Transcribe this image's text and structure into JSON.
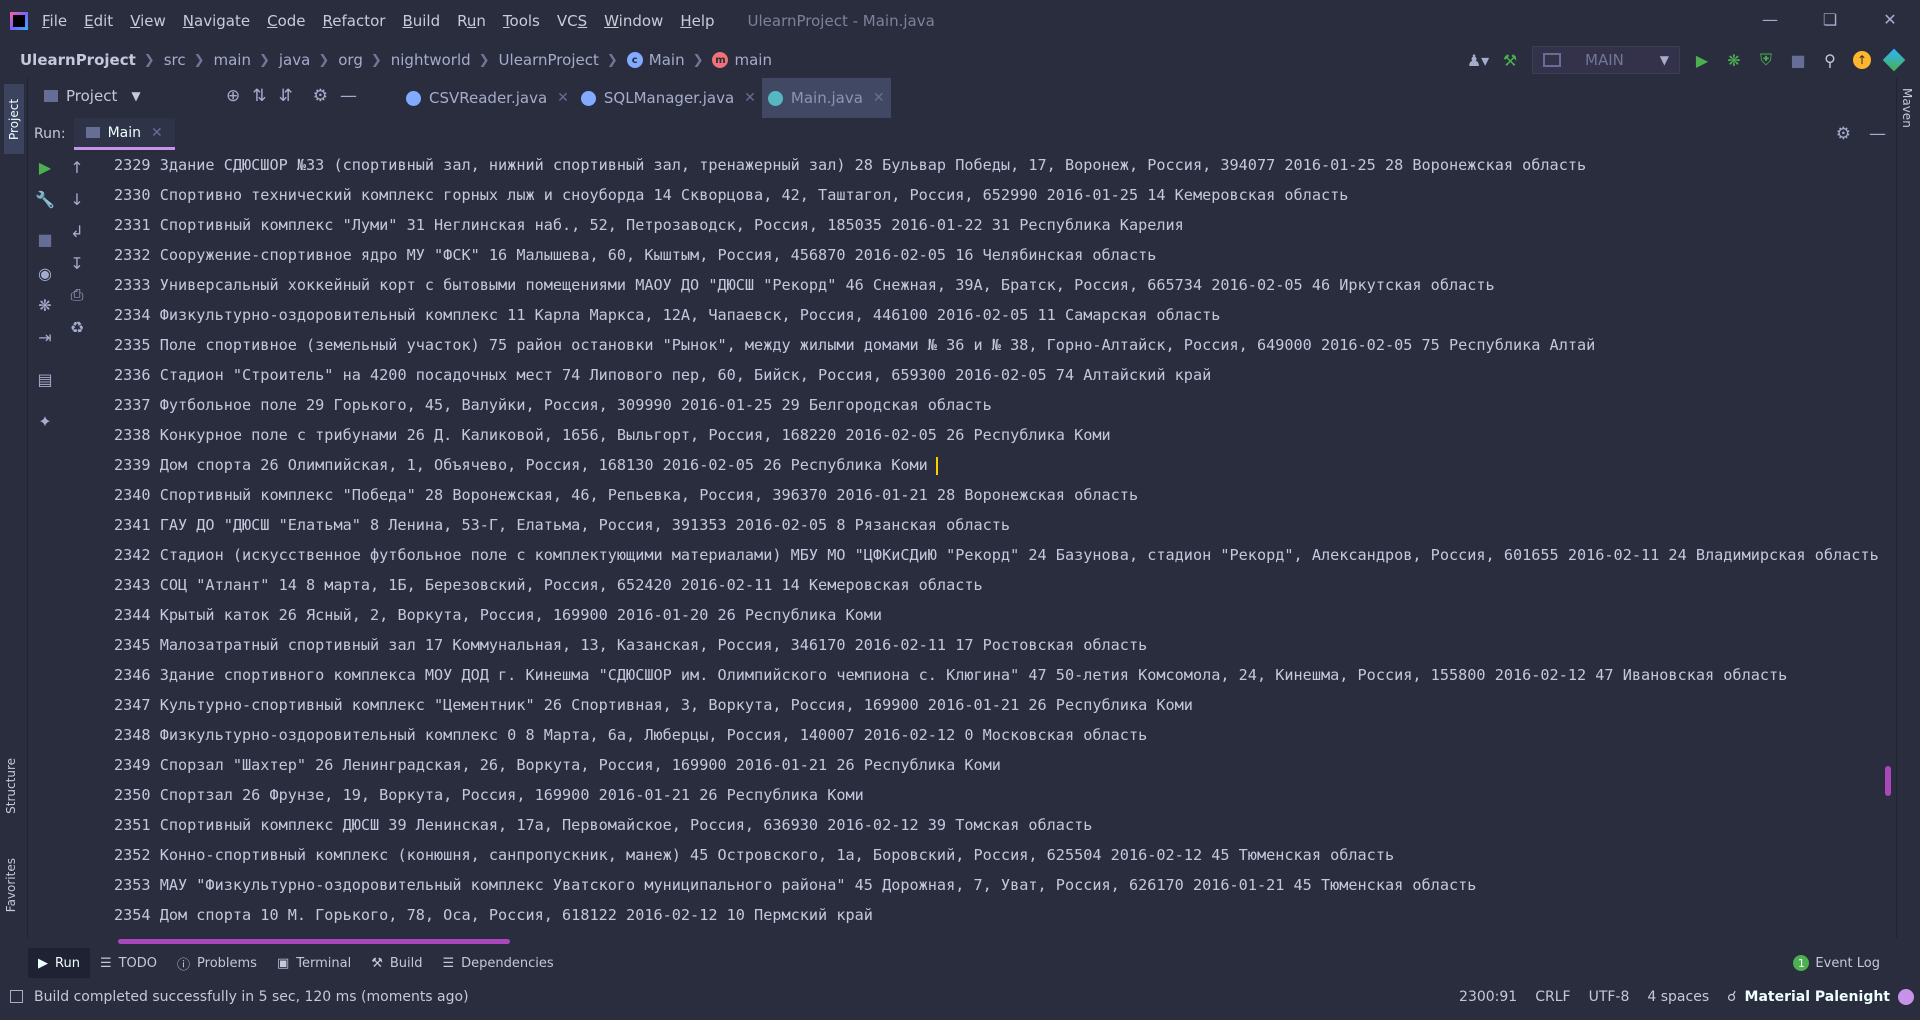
{
  "menu": [
    {
      "label": "File",
      "u": "F"
    },
    {
      "label": "Edit",
      "u": "E"
    },
    {
      "label": "View",
      "u": "V"
    },
    {
      "label": "Navigate",
      "u": "N"
    },
    {
      "label": "Code",
      "u": "C"
    },
    {
      "label": "Refactor",
      "u": "R"
    },
    {
      "label": "Build",
      "u": "B"
    },
    {
      "label": "Run",
      "u": "u"
    },
    {
      "label": "Tools",
      "u": "T"
    },
    {
      "label": "VCS",
      "u": "S"
    },
    {
      "label": "Window",
      "u": "W"
    },
    {
      "label": "Help",
      "u": "H"
    }
  ],
  "window_title": "UlearnProject - Main.java",
  "breadcrumbs": {
    "project": "UlearnProject",
    "items": [
      "src",
      "main",
      "java",
      "org",
      "nightworld",
      "UlearnProject"
    ],
    "class": "Main",
    "method": "main"
  },
  "run_config": {
    "label": "MAIN"
  },
  "project_panel": {
    "label": "Project"
  },
  "editor_tabs": [
    "CSVReader.java",
    "SQLManager.java",
    "Main.java"
  ],
  "run_panel": {
    "label": "Run:",
    "tab": "Main"
  },
  "side_tabs": {
    "project": "Project",
    "structure": "Structure",
    "favorites": "Favorites",
    "maven": "Maven"
  },
  "console_lines": [
    "2329 Здание СДЮСШОР №33 (спортивный зал, нижний спортивный зал, тренажерный зал) 28 Бульвар Победы, 17, Воронеж, Россия, 394077 2016-01-25 28 Воронежская область",
    "2330 Спортивно технический комплекс горных лыж и сноуборда 14 Скворцова, 42, Таштагол, Россия, 652990 2016-01-25 14 Кемеровская область",
    "2331 Спортивный комплекс \"Луми\" 31 Неглинская наб., 52, Петрозаводск, Россия, 185035 2016-01-22 31 Республика Карелия",
    "2332 Сооружение-спортивное ядро МУ \"ФСК\" 16 Малышева, 60, Кыштым, Россия, 456870 2016-02-05 16 Челябинская область",
    "2333 Универсальный хоккейный корт с бытовыми помещениями МАОУ ДО \"ДЮСШ \"Рекорд\" 46 Снежная, 39А, Братск, Россия, 665734 2016-02-05 46 Иркутская область",
    "2334 Физкультурно-оздоровительный комплекс 11 Карла Маркса, 12А, Чапаевск, Россия, 446100 2016-02-05 11 Самарская область",
    "2335 Поле спортивное (земельный участок) 75 район остановки \"Рынок\", между жилыми домами № 36 и № 38, Горно-Алтайск, Россия, 649000 2016-02-05 75 Республика Алтай",
    "2336 Стадион \"Строитель\" на 4200 посадочных мест 74 Липового пер, 60, Бийск, Россия, 659300 2016-02-05 74 Алтайский край",
    "2337 Футбольное поле 29 Горького, 45, Валуйки, Россия, 309990 2016-01-25 29 Белгородская область",
    "2338 Конкурное поле с трибунами 26 Д. Каликовой, 1656, Выльгорт, Россия, 168220 2016-02-05 26 Республика Коми",
    "2339 Дом спорта 26 Олимпийская, 1, Объячево, Россия, 168130 2016-02-05 26 Республика Коми",
    "2340 Спортивный комплекс \"Победа\" 28 Воронежская, 46, Репьевка, Россия, 396370 2016-01-21 28 Воронежская область",
    "2341 ГАУ ДО \"ДЮСШ \"Елатьма\" 8 Ленина, 53-Г, Елатьма, Россия, 391353 2016-02-05 8 Рязанская область",
    "2342 Стадион (искусственное футбольное поле с комплектующими материалами) МБУ МО \"ЦФКиСДиЮ \"Рекорд\" 24 Базунова, стадион \"Рекорд\", Александров, Россия, 601655 2016-02-11 24 Владимирская область",
    "2343 СОЦ \"Атлант\" 14 8 марта, 1Б, Березовский, Россия, 652420 2016-02-11 14 Кемеровская область",
    "2344 Крытый каток 26 Ясный, 2, Воркута, Россия, 169900 2016-01-20 26 Республика Коми",
    "2345 Малозатратный спортивный зал 17 Коммунальная, 13, Казанская, Россия, 346170 2016-02-11 17 Ростовская область",
    "2346 Здание спортивного комплекса МОУ ДОД г. Кинешма \"СДЮСШОР им. Олимпийского чемпиона с. Клюгина\" 47 50-летия Комсомола, 24, Кинешма, Россия, 155800 2016-02-12 47 Ивановская область",
    "2347 Культурно-спортивный комплекс \"Цементник\" 26 Спортивная, 3, Воркута, Россия, 169900 2016-01-21 26 Республика Коми",
    "2348 Физкультурно-оздоровительный комплекс 0 8 Марта, 6а, Люберцы, Россия, 140007 2016-02-12 0 Московская область",
    "2349 Спорзал \"Шахтер\" 26 Ленинградская, 26, Воркута, Россия, 169900 2016-01-21 26 Республика Коми",
    "2350 Спортзал 26 Фрунзе, 19, Воркута, Россия, 169900 2016-01-21 26 Республика Коми",
    "2351 Спортивный комплекс ДЮСШ 39 Ленинская, 17а, Первомайское, Россия, 636930 2016-02-12 39 Томская область",
    "2352 Конно-спортивный комплекс (конюшня, санпропускник, манеж) 45 Островского, 1а, Боровский, Россия, 625504 2016-02-12 45 Тюменская область",
    "2353 МАУ \"Физкультурно-оздоровительный комплекс Уватского муниципального района\" 45 Дорожная, 7, Уват, Россия, 626170 2016-01-21 45 Тюменская область",
    "2354 Дом спорта 10 М. Горького, 78, Оса, Россия, 618122 2016-02-12 10 Пермский край"
  ],
  "bottom_tabs": [
    "Run",
    "TODO",
    "Problems",
    "Terminal",
    "Build",
    "Dependencies"
  ],
  "event_log": {
    "label": "Event Log",
    "count": "1"
  },
  "status": {
    "message": "Build completed successfully in 5 sec, 120 ms (moments ago)",
    "position": "2300:91",
    "line_sep": "CRLF",
    "encoding": "UTF-8",
    "indent": "4 spaces",
    "theme": "Material Palenight"
  },
  "colors": {
    "accent": "#c792ea",
    "background": "#292d3e",
    "run_green": "#4caf50",
    "caret": "#ffcc00"
  }
}
